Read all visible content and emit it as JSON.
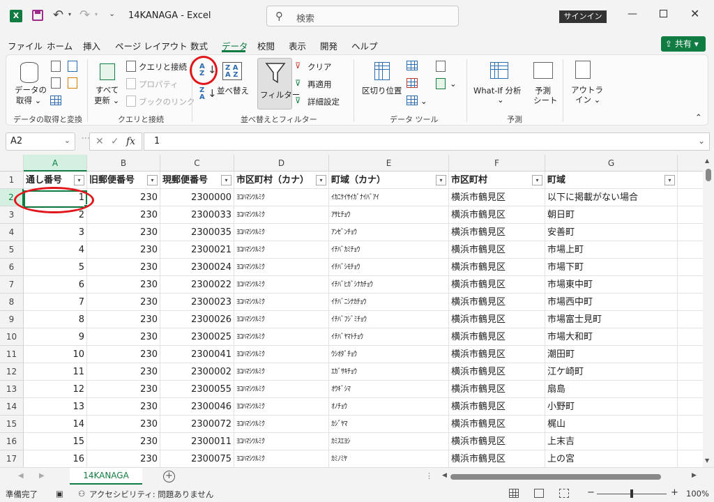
{
  "titlebar": {
    "app_icon": "excel-logo",
    "app_letter": "X",
    "doc_title": "14KANAGA  -  Excel",
    "search_placeholder": "検索",
    "signin": "サインイン",
    "minimize": "—",
    "close": "✕"
  },
  "menu": {
    "tabs": [
      "ファイル",
      "ホーム",
      "挿入",
      "ページ レイアウト",
      "数式",
      "データ",
      "校閲",
      "表示",
      "開発",
      "ヘルプ"
    ],
    "active_index": 5,
    "share": "共有"
  },
  "ribbon": {
    "get_data": {
      "label1": "データの",
      "label2": "取得"
    },
    "refresh_all": {
      "label1": "すべて",
      "label2": "更新"
    },
    "queries_connections": "クエリと接続",
    "properties": "プロパティ",
    "edit_links": "ブックのリンク",
    "sort_label": "並べ替え",
    "filter_label": "フィルター",
    "clear": "クリア",
    "reapply": "再適用",
    "advanced": "詳細設定",
    "text_to_columns": "区切り位置",
    "what_if": "What-If 分析",
    "forecast1": "予測",
    "forecast2": "シート",
    "outline1": "アウトラ",
    "outline2": "イン",
    "groups": {
      "get_transform": "データの取得と変換",
      "queries": "クエリと接続",
      "sort_filter": "並べ替えとフィルター",
      "data_tools": "データ ツール",
      "forecast": "予測"
    }
  },
  "formula_bar": {
    "name_box": "A2",
    "cancel": "✕",
    "enter": "✓",
    "fx": "fx",
    "value": "1"
  },
  "grid": {
    "columns": [
      "A",
      "B",
      "C",
      "D",
      "E",
      "F",
      "G"
    ],
    "headers": [
      "通し番号",
      "旧郵便番号",
      "現郵便番号",
      "市区町村（カナ）",
      "町域（カナ）",
      "市区町村",
      "町域"
    ],
    "rows": [
      [
        "1",
        "230",
        "2300000",
        "ﾖｺﾊﾏｼﾂﾙﾐｸ",
        "ｲｶﾆｹｲｻｲｶﾞﾅｲﾊﾞｱｲ",
        "横浜市鶴見区",
        "以下に掲載がない場合"
      ],
      [
        "2",
        "230",
        "2300033",
        "ﾖｺﾊﾏｼﾂﾙﾐｸ",
        "ｱｻﾋﾁｮｳ",
        "横浜市鶴見区",
        "朝日町"
      ],
      [
        "3",
        "230",
        "2300035",
        "ﾖｺﾊﾏｼﾂﾙﾐｸ",
        "ｱﾝｾﾞﾝﾁｮｳ",
        "横浜市鶴見区",
        "安善町"
      ],
      [
        "4",
        "230",
        "2300021",
        "ﾖｺﾊﾏｼﾂﾙﾐｸ",
        "ｲﾁﾊﾞｶﾐﾁｮｳ",
        "横浜市鶴見区",
        "市場上町"
      ],
      [
        "5",
        "230",
        "2300024",
        "ﾖｺﾊﾏｼﾂﾙﾐｸ",
        "ｲﾁﾊﾞｼﾓﾁｮｳ",
        "横浜市鶴見区",
        "市場下町"
      ],
      [
        "6",
        "230",
        "2300022",
        "ﾖｺﾊﾏｼﾂﾙﾐｸ",
        "ｲﾁﾊﾞﾋｶﾞｼﾅｶﾁｮｳ",
        "横浜市鶴見区",
        "市場東中町"
      ],
      [
        "7",
        "230",
        "2300023",
        "ﾖｺﾊﾏｼﾂﾙﾐｸ",
        "ｲﾁﾊﾞﾆｼﾅｶﾁｮｳ",
        "横浜市鶴見区",
        "市場西中町"
      ],
      [
        "8",
        "230",
        "2300026",
        "ﾖｺﾊﾏｼﾂﾙﾐｸ",
        "ｲﾁﾊﾞﾌｼﾞﾐﾁｮｳ",
        "横浜市鶴見区",
        "市場富士見町"
      ],
      [
        "9",
        "230",
        "2300025",
        "ﾖｺﾊﾏｼﾂﾙﾐｸ",
        "ｲﾁﾊﾞﾔﾏﾄﾁｮｳ",
        "横浜市鶴見区",
        "市場大和町"
      ],
      [
        "10",
        "230",
        "2300041",
        "ﾖｺﾊﾏｼﾂﾙﾐｸ",
        "ｳｼｵﾀﾞﾁｮｳ",
        "横浜市鶴見区",
        "潮田町"
      ],
      [
        "11",
        "230",
        "2300002",
        "ﾖｺﾊﾏｼﾂﾙﾐｸ",
        "ｴｶﾞｻｷﾁｮｳ",
        "横浜市鶴見区",
        "江ケ崎町"
      ],
      [
        "12",
        "230",
        "2300055",
        "ﾖｺﾊﾏｼﾂﾙﾐｸ",
        "ｵｳｷﾞｼﾏ",
        "横浜市鶴見区",
        "扇島"
      ],
      [
        "13",
        "230",
        "2300046",
        "ﾖｺﾊﾏｼﾂﾙﾐｸ",
        "ｵﾉﾁｮｳ",
        "横浜市鶴見区",
        "小野町"
      ],
      [
        "14",
        "230",
        "2300072",
        "ﾖｺﾊﾏｼﾂﾙﾐｸ",
        "ｶｼﾞﾔﾏ",
        "横浜市鶴見区",
        "梶山"
      ],
      [
        "15",
        "230",
        "2300011",
        "ﾖｺﾊﾏｼﾂﾙﾐｸ",
        "ｶﾐｽｴﾖｼ",
        "横浜市鶴見区",
        "上末吉"
      ],
      [
        "16",
        "230",
        "2300075",
        "ﾖｺﾊﾏｼﾂﾙﾐｸ",
        "ｶﾐﾉﾐﾔ",
        "横浜市鶴見区",
        "上の宮"
      ]
    ]
  },
  "sheets": {
    "active": "14KANAGA",
    "add": "+"
  },
  "status": {
    "ready": "準備完了",
    "accessibility": "アクセシビリティ: 問題ありません",
    "zoom": "100%"
  }
}
